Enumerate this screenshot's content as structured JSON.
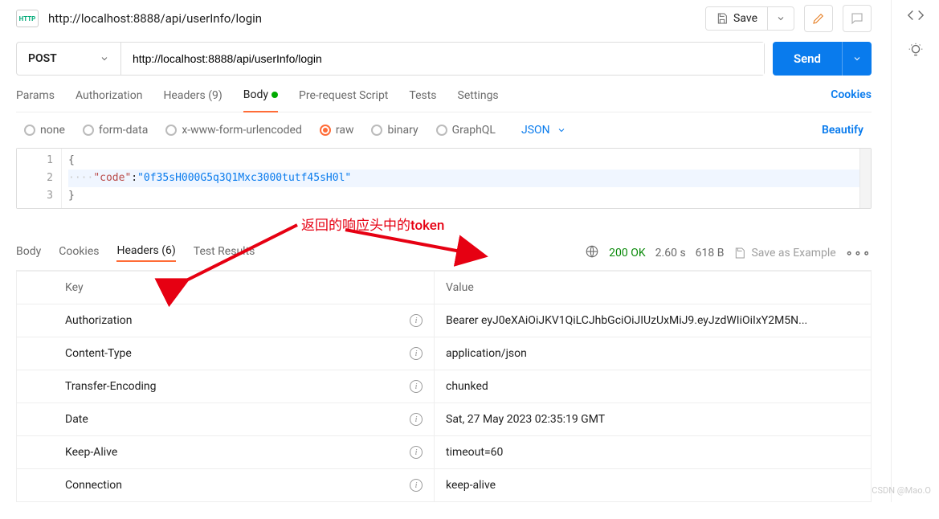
{
  "header": {
    "http_badge": "HTTP",
    "tab_title": "http://localhost:8888/api/userInfo/login",
    "save_label": "Save"
  },
  "request": {
    "method": "POST",
    "url": "http://localhost:8888/api/userInfo/login",
    "send_label": "Send",
    "tabs": {
      "params": "Params",
      "authorization": "Authorization",
      "headers": "Headers (9)",
      "body": "Body",
      "prerequest": "Pre-request Script",
      "tests": "Tests",
      "settings": "Settings"
    },
    "cookies_link": "Cookies",
    "body_types": {
      "none": "none",
      "form_data": "form-data",
      "xwww": "x-www-form-urlencoded",
      "raw": "raw",
      "binary": "binary",
      "graphql": "GraphQL"
    },
    "content_type": "JSON",
    "beautify": "Beautify",
    "editor": {
      "lines": [
        "1",
        "2",
        "3"
      ],
      "line1": "{",
      "line2_key": "\"code\"",
      "line2_sep": ":",
      "line2_val": "\"0f35sH000G5q3Q1Mxc3000tutf45sH0l\"",
      "line3": "}"
    }
  },
  "annotation": "返回的响应头中的token",
  "response": {
    "tabs": {
      "body": "Body",
      "cookies": "Cookies",
      "headers": "Headers (6)",
      "test_results": "Test Results"
    },
    "status": "200 OK",
    "time": "2.60 s",
    "size": "618 B",
    "save_example": "Save as Example",
    "columns": {
      "key": "Key",
      "value": "Value"
    },
    "headers": [
      {
        "key": "Authorization",
        "value": "Bearer eyJ0eXAiOiJKV1QiLCJhbGciOiJIUzUxMiJ9.eyJzdWIiOiIxY2M5N..."
      },
      {
        "key": "Content-Type",
        "value": "application/json"
      },
      {
        "key": "Transfer-Encoding",
        "value": "chunked"
      },
      {
        "key": "Date",
        "value": "Sat, 27 May 2023 02:35:19 GMT"
      },
      {
        "key": "Keep-Alive",
        "value": "timeout=60"
      },
      {
        "key": "Connection",
        "value": "keep-alive"
      }
    ]
  },
  "watermark": "CSDN @Mao.O"
}
